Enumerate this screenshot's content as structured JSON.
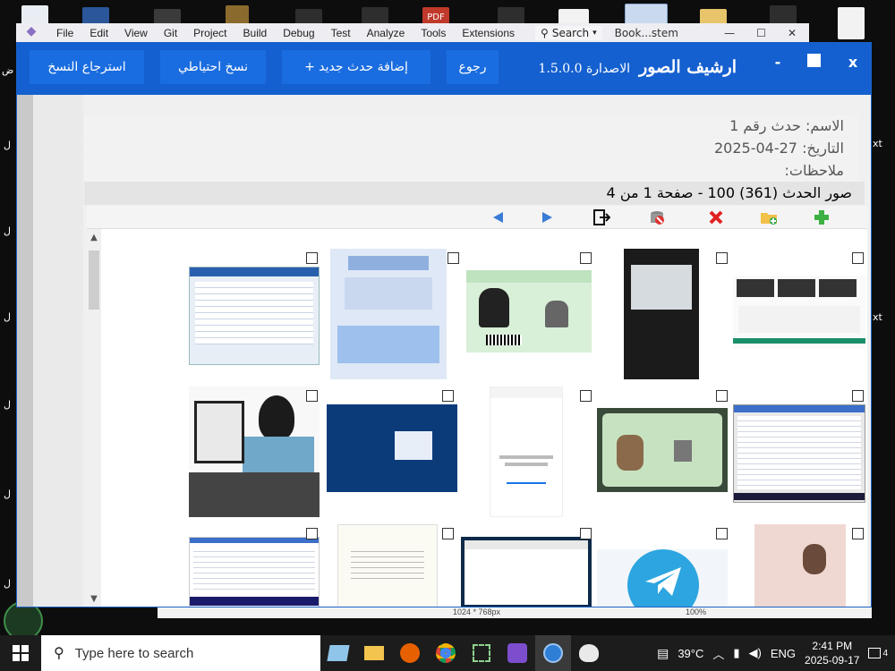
{
  "vs": {
    "menu": [
      "File",
      "Edit",
      "View",
      "Git",
      "Project",
      "Build",
      "Debug",
      "Test",
      "Analyze",
      "Tools",
      "Extensions"
    ],
    "search_label": "Search",
    "window_title": "Book...stem"
  },
  "desktop": {
    "left_labels": [
      "ض",
      "ل",
      "ل",
      "ل",
      "ل",
      "ل",
      "ل"
    ],
    "right_labels": [
      "xt",
      "xt"
    ],
    "pdf_label": "PDF"
  },
  "app": {
    "title": "ارشيف الصور",
    "version": "الاصدارة 1.5.0.0",
    "buttons": {
      "back": "رجوع",
      "add_event": "+ إضافة حدث جديد",
      "backup": "نسخ احتياطي",
      "restore": "استرجاع النسخ"
    },
    "window_controls": {
      "minimize": "-",
      "close": "x"
    },
    "info": {
      "name": "الاسم: حدث رقم 1",
      "date": "التاريخ: 27-04-2025",
      "notes": "ملاحظات:"
    },
    "gallery_header": "صور الحدث (361) 100 -  صفحة 1 من 4",
    "toolbar": [
      "add-icon",
      "add-folder-icon",
      "delete-icon",
      "delete-all-icon",
      "export-icon",
      "next-icon",
      "prev-icon"
    ],
    "bottom_fragments": {
      "left": "1024 * 768px",
      "right": "100%"
    }
  },
  "taskbar": {
    "search_placeholder": "Type here to search",
    "temperature": "39°C",
    "language": "ENG",
    "time": "2:41 PM",
    "date": "2025-09-17",
    "notifications": "4"
  },
  "colors": {
    "titlebar": "#1560d0",
    "button": "#1a6de0",
    "taskbar": "#1c1c1c"
  }
}
